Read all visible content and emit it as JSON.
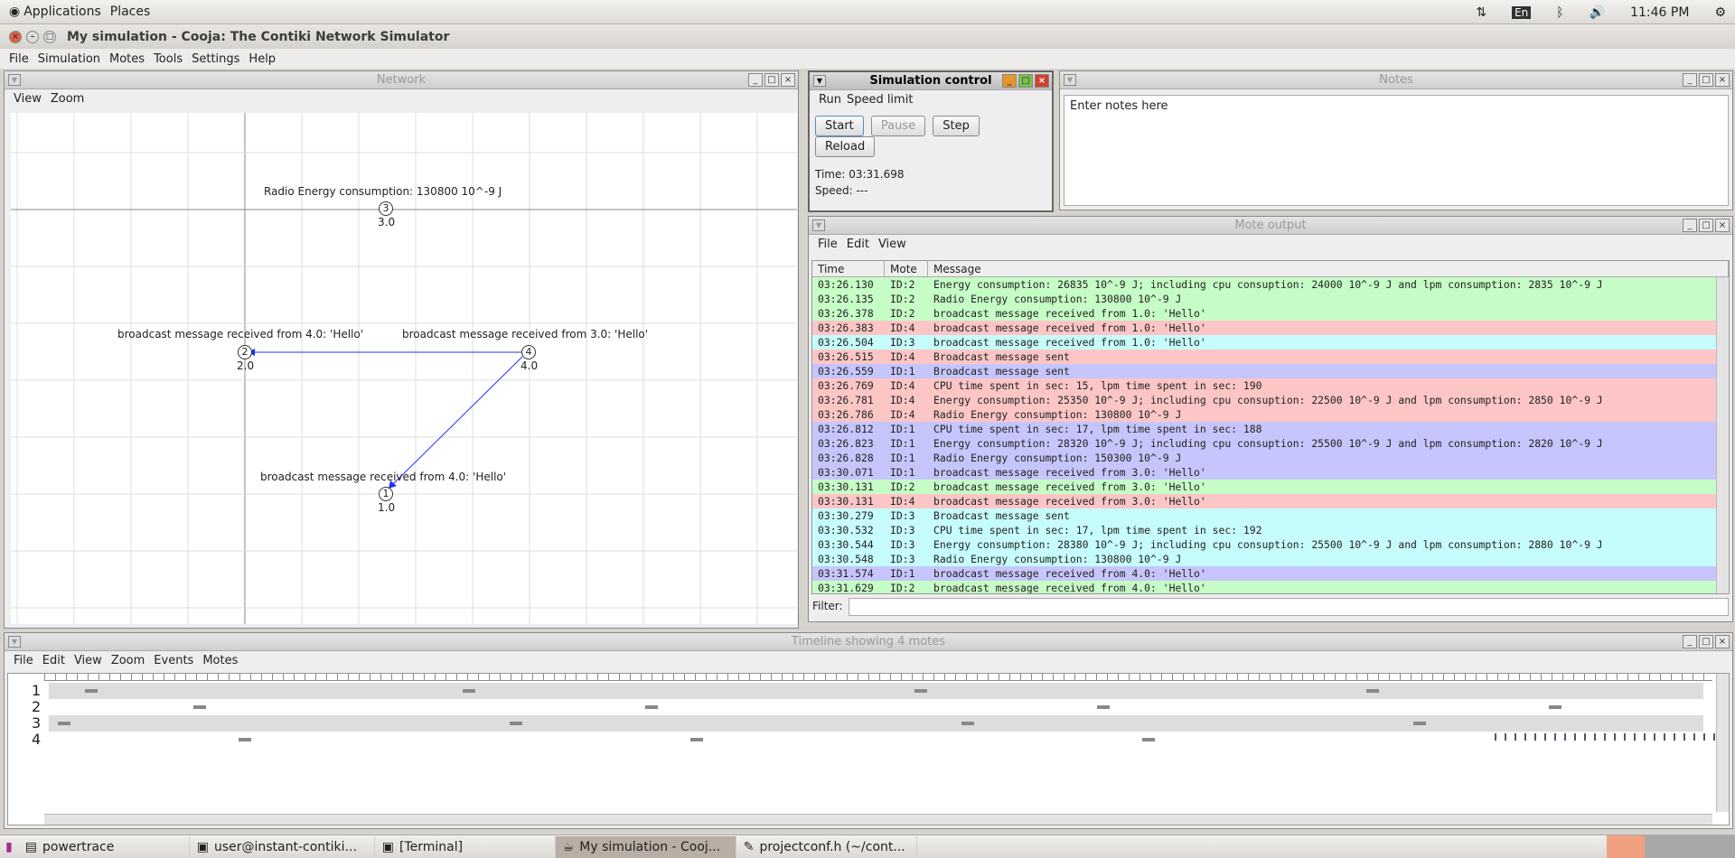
{
  "top_panel": {
    "applications": "Applications",
    "places": "Places",
    "keyboard": "En",
    "clock": "11:46 PM"
  },
  "window": {
    "title": "My simulation - Cooja: The Contiki Network Simulator"
  },
  "menu": [
    "File",
    "Simulation",
    "Motes",
    "Tools",
    "Settings",
    "Help"
  ],
  "network": {
    "title": "Network",
    "menu": [
      "View",
      "Zoom"
    ],
    "nodes": [
      {
        "id": "1",
        "pos": "1.0",
        "label": "broadcast message received from 4.0: 'Hello'"
      },
      {
        "id": "2",
        "pos": "2.0",
        "label": "broadcast message received from 4.0: 'Hello'"
      },
      {
        "id": "3",
        "pos": "3.0",
        "label": "Radio Energy consumption: 130800 10^-9 J"
      },
      {
        "id": "4",
        "pos": "4.0",
        "label": "broadcast message received from 3.0: 'Hello'"
      }
    ]
  },
  "sim_control": {
    "title": "Simulation control",
    "menu": [
      "Run",
      "Speed limit"
    ],
    "buttons": [
      "Start",
      "Pause",
      "Step",
      "Reload"
    ],
    "time": "Time: 03:31.698",
    "speed": "Speed: ---"
  },
  "notes": {
    "title": "Notes",
    "text": "Enter notes here"
  },
  "mote_output": {
    "title": "Mote output",
    "menu": [
      "File",
      "Edit",
      "View"
    ],
    "columns": [
      "Time",
      "Mote",
      "Message"
    ],
    "filter_label": "Filter:",
    "colors": {
      "ID:1": "#c6c6fc",
      "ID:2": "#c6fcc6",
      "ID:3": "#c6fcfc",
      "ID:4": "#fcc6c6"
    },
    "rows": [
      [
        "03:26.130",
        "ID:2",
        "Energy consumption: 26835 10^-9 J; including cpu consuption: 24000 10^-9 J and lpm consumption: 2835 10^-9 J"
      ],
      [
        "03:26.135",
        "ID:2",
        "Radio Energy consumption: 130800 10^-9 J"
      ],
      [
        "03:26.378",
        "ID:2",
        "broadcast message received from 1.0: 'Hello'"
      ],
      [
        "03:26.383",
        "ID:4",
        "broadcast message received from 1.0: 'Hello'"
      ],
      [
        "03:26.504",
        "ID:3",
        "broadcast message received from 1.0: 'Hello'"
      ],
      [
        "03:26.515",
        "ID:4",
        "Broadcast message sent"
      ],
      [
        "03:26.559",
        "ID:1",
        "Broadcast message sent"
      ],
      [
        "03:26.769",
        "ID:4",
        "CPU time spent in sec: 15, lpm time spent in sec: 190"
      ],
      [
        "03:26.781",
        "ID:4",
        "Energy consumption: 25350 10^-9 J; including cpu consuption: 22500 10^-9 J and lpm consumption: 2850 10^-9 J"
      ],
      [
        "03:26.786",
        "ID:4",
        "Radio Energy consumption: 130800 10^-9 J"
      ],
      [
        "03:26.812",
        "ID:1",
        "CPU time spent in sec: 17, lpm time spent in sec: 188"
      ],
      [
        "03:26.823",
        "ID:1",
        "Energy consumption: 28320 10^-9 J; including cpu consuption: 25500 10^-9 J and lpm consumption: 2820 10^-9 J"
      ],
      [
        "03:26.828",
        "ID:1",
        "Radio Energy consumption: 150300 10^-9 J"
      ],
      [
        "03:30.071",
        "ID:1",
        "broadcast message received from 3.0: 'Hello'"
      ],
      [
        "03:30.131",
        "ID:2",
        "broadcast message received from 3.0: 'Hello'"
      ],
      [
        "03:30.131",
        "ID:4",
        "broadcast message received from 3.0: 'Hello'"
      ],
      [
        "03:30.279",
        "ID:3",
        "Broadcast message sent"
      ],
      [
        "03:30.532",
        "ID:3",
        "CPU time spent in sec: 17, lpm time spent in sec: 192"
      ],
      [
        "03:30.544",
        "ID:3",
        "Energy consumption: 28380 10^-9 J; including cpu consuption: 25500 10^-9 J and lpm consumption: 2880 10^-9 J"
      ],
      [
        "03:30.548",
        "ID:3",
        "Radio Energy consumption: 130800 10^-9 J"
      ],
      [
        "03:31.574",
        "ID:1",
        "broadcast message received from 4.0: 'Hello'"
      ],
      [
        "03:31.629",
        "ID:2",
        "broadcast message received from 4.0: 'Hello'"
      ]
    ]
  },
  "timeline": {
    "title": "Timeline showing 4 motes",
    "menu": [
      "File",
      "Edit",
      "View",
      "Zoom",
      "Events",
      "Motes"
    ],
    "motes": [
      "1",
      "2",
      "3",
      "4"
    ]
  },
  "taskbar": [
    "powertrace",
    "user@instant-contiki...",
    "[Terminal]",
    "My simulation - Cooj...",
    "projectconf.h (~/cont..."
  ]
}
